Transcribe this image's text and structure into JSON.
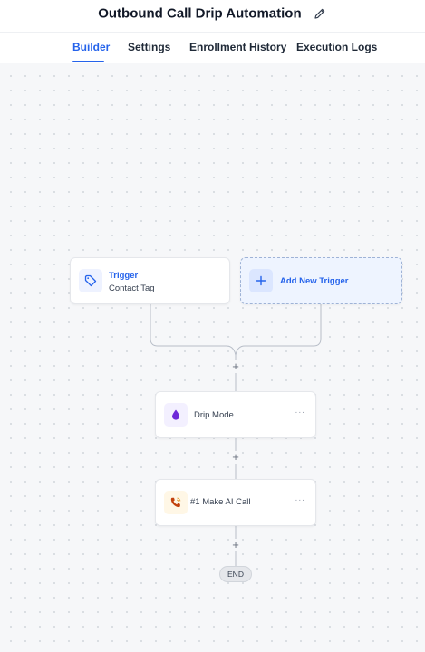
{
  "header": {
    "title": "Outbound Call Drip Automation",
    "edit_icon": "pencil-icon"
  },
  "tabs": [
    {
      "label": "Builder",
      "active": true
    },
    {
      "label": "Settings",
      "active": false
    },
    {
      "label": "Enrollment History",
      "active": false
    },
    {
      "label": "Execution Logs",
      "active": false
    }
  ],
  "workflow": {
    "trigger": {
      "kind": "Trigger",
      "name": "Contact Tag",
      "icon": "tag-icon"
    },
    "add_trigger": {
      "label": "Add New Trigger",
      "icon": "plus-icon"
    },
    "add_step_label": "+",
    "steps": [
      {
        "label": "Drip Mode",
        "icon": "drop-icon",
        "menu": "···"
      },
      {
        "label": "#1 Make AI Call",
        "icon": "phone-call-icon",
        "menu": "···"
      }
    ],
    "end_label": "END"
  },
  "colors": {
    "accent": "#2563eb",
    "canvas_bg": "#f6f7f9",
    "drip_icon": "#7c3aed",
    "call_icon": "#c2410c"
  }
}
